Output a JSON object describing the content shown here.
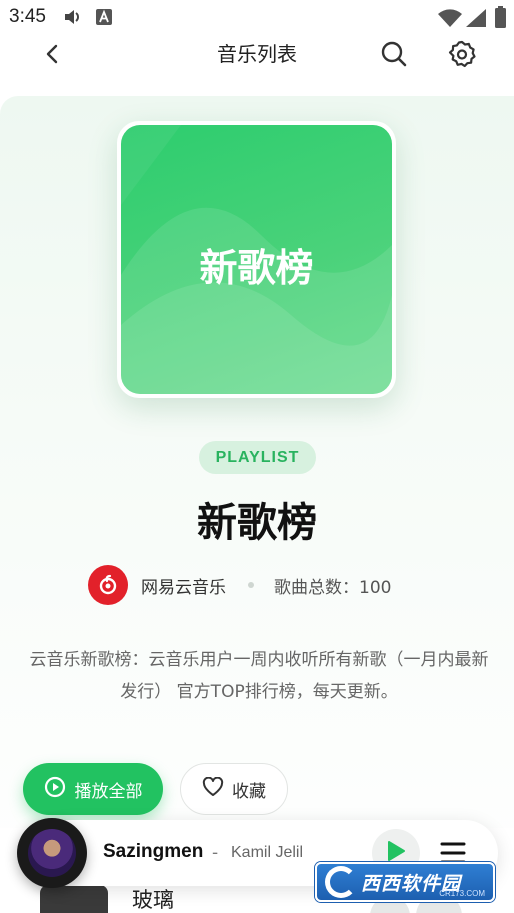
{
  "status_bar": {
    "time": "3:45",
    "icons": [
      "volume-icon",
      "a-notification-icon",
      "wifi-icon",
      "signal-icon",
      "battery-icon"
    ]
  },
  "app_bar": {
    "title": "音乐列表",
    "icons": [
      "back-icon",
      "search-icon",
      "settings-icon"
    ]
  },
  "playlist": {
    "cover_title": "新歌榜",
    "tag": "PLAYLIST",
    "title": "新歌榜",
    "source": "网易云音乐",
    "song_count": "歌曲总数：100",
    "description": "云音乐新歌榜：云音乐用户一周内收听所有新歌（一月内最新发行） 官方TOP排行榜，每天更新。",
    "play_all_label": "播放全部",
    "favorite_label": "收藏"
  },
  "song_list": [
    {
      "title": "玻璃"
    }
  ],
  "now_playing": {
    "title": "Sazingmen",
    "separator": "-",
    "artist": "Kamil Jelil"
  },
  "watermark": {
    "text": "西西软件园",
    "sub": "CR173.COM"
  },
  "colors": {
    "accent": "#22c261",
    "tag_bg": "#d7f1df",
    "brand_red": "#e2212a"
  }
}
